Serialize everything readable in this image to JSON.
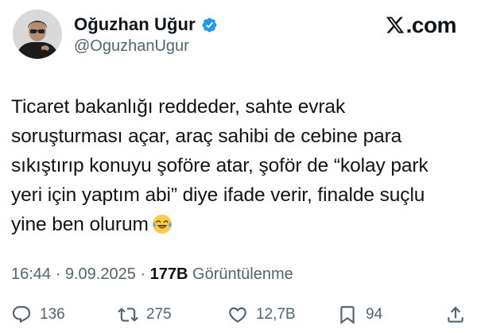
{
  "author": {
    "display_name": "Oğuzhan Uğur",
    "handle": "@OguzhanUgur"
  },
  "site": {
    "logo_text": ".com",
    "icon": "x-logo-icon"
  },
  "tweet": {
    "text": "Ticaret bakanlığı reddeder, sahte evrak\nsoruşturması açar, araç sahibi de cebine para\nsıkıştırıp konuyu şoföre atar, şoför de “kolay park\nyeri için yaptım abi” diye ifade verir, finalde suçlu\nyine ben olurum",
    "emoji": "face-with-tears-of-joy-emoji"
  },
  "meta": {
    "time": "16:44",
    "separator": "·",
    "date": "9.09.2025",
    "views_count": "177B",
    "views_label": "Görüntülenme"
  },
  "actions": {
    "replies": "136",
    "reposts": "275",
    "likes": "12,7B",
    "bookmarks": "94"
  },
  "colors": {
    "text": "#0f1419",
    "secondary": "#536471",
    "verified": "#1d9bf0"
  }
}
